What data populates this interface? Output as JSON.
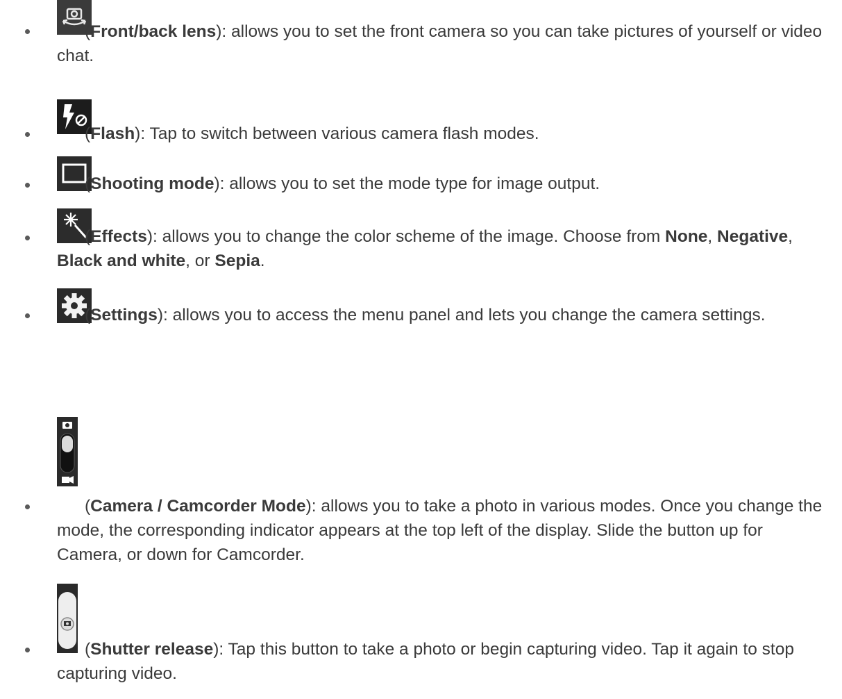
{
  "items": [
    {
      "icon": "front-back-lens-icon",
      "name": "Front/back lens",
      "desc": "): allows you to set the front camera so you can take pictures of yourself or video chat."
    },
    {
      "icon": "flash-off-icon",
      "name": "Flash",
      "desc": "): Tap to switch between various camera flash modes."
    },
    {
      "icon": "shooting-mode-icon",
      "name": "Shooting mode",
      "desc": "): allows you to set the mode type for image output."
    },
    {
      "icon": "effects-wand-icon",
      "name": "Effects",
      "desc_a": "): allows you to change the color scheme of the image. Choose from ",
      "opt1": "None",
      "sep1": ",",
      "opt2": "Negative",
      "sep2": ", ",
      "opt3": "Black and white",
      "sep3": ", or ",
      "opt4": "Sepia",
      "end": "."
    },
    {
      "icon": "settings-gear-icon",
      "name": "Settings",
      "desc": "): allows you to access the menu panel and lets you change the camera settings."
    },
    {
      "icon": "camera-camcorder-switch-icon",
      "name": "Camera / Camcorder Mode",
      "desc": "): allows you to take a photo in various modes. Once you change the mode, the corresponding indicator appears at the top left of the display. Slide the button up for Camera, or down for Camcorder."
    },
    {
      "icon": "shutter-release-icon",
      "name": "Shutter release",
      "desc": "): Tap this button to take a photo or begin capturing video. Tap it again to stop capturing video."
    }
  ],
  "open_paren": "("
}
